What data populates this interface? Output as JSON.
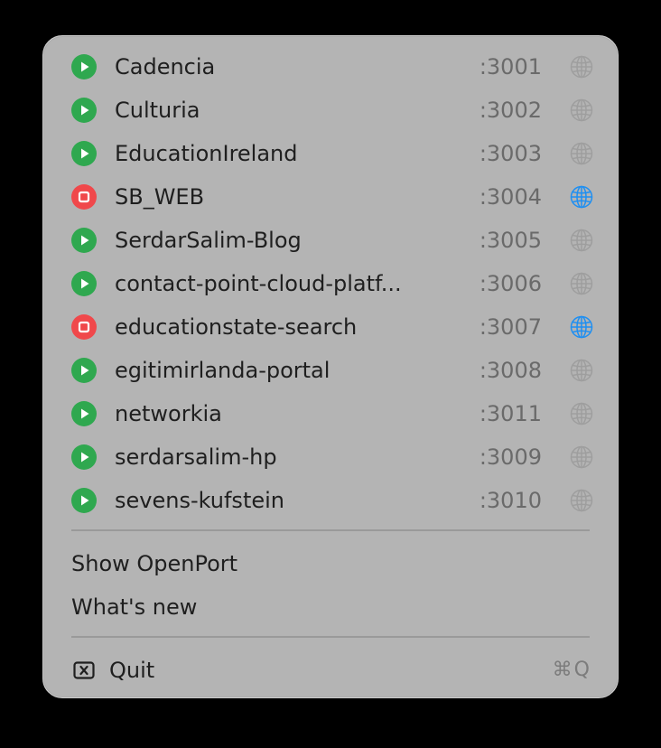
{
  "projects": [
    {
      "name": "Cadencia",
      "port": ":3001",
      "status": "running",
      "status_icon": "play-icon",
      "globe_active": false
    },
    {
      "name": "Culturia",
      "port": ":3002",
      "status": "running",
      "status_icon": "play-icon",
      "globe_active": false
    },
    {
      "name": "EducationIreland",
      "port": ":3003",
      "status": "running",
      "status_icon": "play-icon",
      "globe_active": false
    },
    {
      "name": "SB_WEB",
      "port": ":3004",
      "status": "stopped",
      "status_icon": "stop-icon",
      "globe_active": true
    },
    {
      "name": "SerdarSalim-Blog",
      "port": ":3005",
      "status": "running",
      "status_icon": "play-icon",
      "globe_active": false
    },
    {
      "name": "contact-point-cloud-platf...",
      "port": ":3006",
      "status": "running",
      "status_icon": "play-icon",
      "globe_active": false
    },
    {
      "name": "educationstate-search",
      "port": ":3007",
      "status": "stopped",
      "status_icon": "stop-icon",
      "globe_active": true
    },
    {
      "name": "egitimirlanda-portal",
      "port": ":3008",
      "status": "running",
      "status_icon": "play-icon",
      "globe_active": false
    },
    {
      "name": "networkia",
      "port": ":3011",
      "status": "running",
      "status_icon": "play-icon",
      "globe_active": false
    },
    {
      "name": "serdarsalim-hp",
      "port": ":3009",
      "status": "running",
      "status_icon": "play-icon",
      "globe_active": false
    },
    {
      "name": "sevens-kufstein",
      "port": ":3010",
      "status": "running",
      "status_icon": "play-icon",
      "globe_active": false
    }
  ],
  "actions": {
    "show_openport": "Show OpenPort",
    "whats_new": "What's new"
  },
  "quit": {
    "label": "Quit",
    "shortcut": "⌘Q",
    "icon": "quit-x-icon"
  },
  "colors": {
    "running": "#2fa84f",
    "stopped": "#f0484b",
    "globe_active": "#1e8ff2",
    "globe_inactive": "#9e9e9e",
    "menu_bg": "#b4b4b4"
  }
}
